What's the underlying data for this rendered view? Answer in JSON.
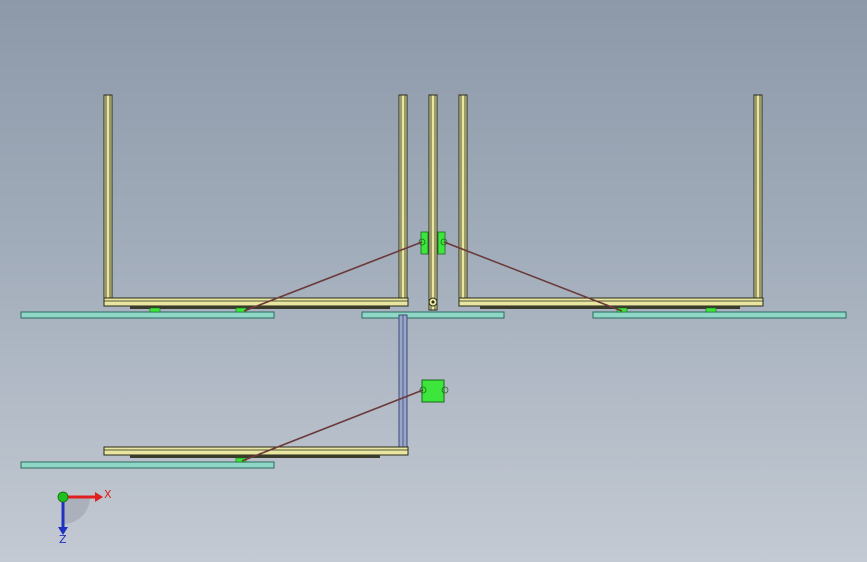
{
  "viewport": {
    "background_top": "#8d99a9",
    "background_bottom": "#c4cad3"
  },
  "colors": {
    "profile_fill": "#e8e6a0",
    "profile_edge": "#2a2a1a",
    "plate_fill": "#8fd8c8",
    "plate_edge": "#2c6a5e",
    "actuator_fill": "#3ce63c",
    "actuator_edge": "#1a6a1a",
    "link_color": "#6b3a3a",
    "vertical_post": "#3a4a7a"
  },
  "triad": {
    "x_label": "X",
    "z_label": "Z",
    "x_color": "#e02020",
    "z_color": "#2030c0",
    "y_color": "#20c020"
  }
}
